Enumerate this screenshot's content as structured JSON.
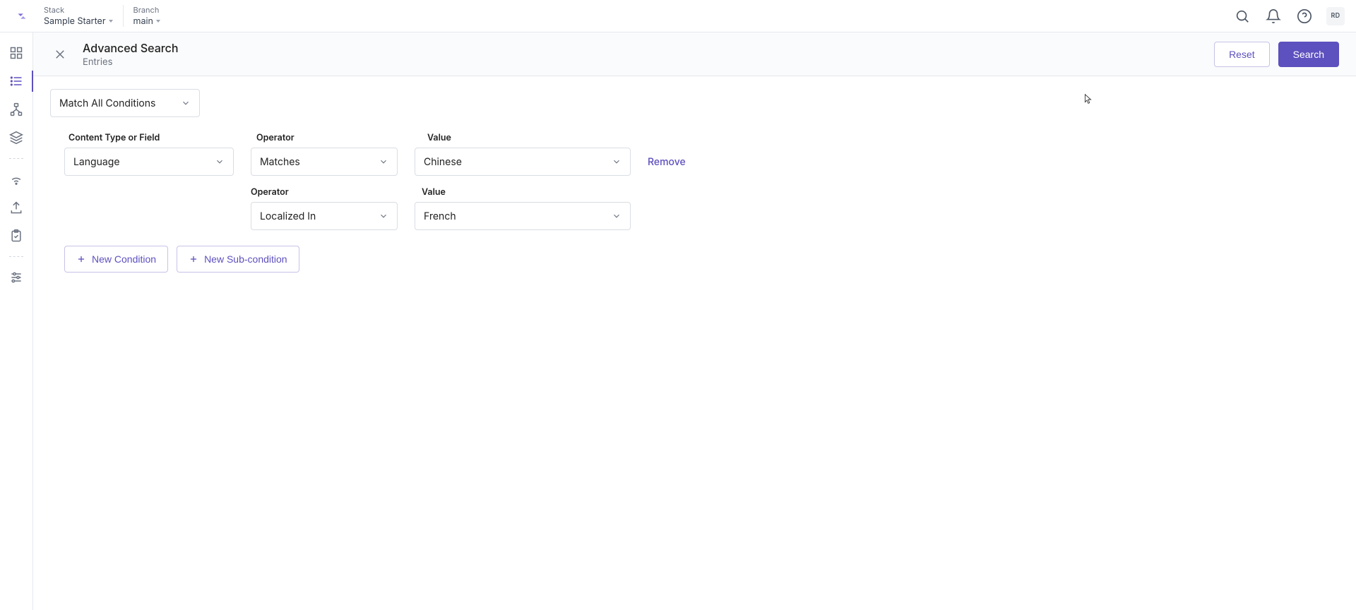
{
  "header": {
    "stack_label": "Stack",
    "stack_value": "Sample Starter",
    "branch_label": "Branch",
    "branch_value": "main",
    "avatar": "RD"
  },
  "subheader": {
    "title": "Advanced Search",
    "subtitle": "Entries",
    "reset": "Reset",
    "search": "Search"
  },
  "match": {
    "label": "Match All Conditions"
  },
  "labels": {
    "content_type": "Content Type or Field",
    "operator": "Operator",
    "value": "Value"
  },
  "condition1": {
    "field": "Language",
    "operator": "Matches",
    "value": "Chinese",
    "remove": "Remove"
  },
  "condition2": {
    "operator": "Localized In",
    "value": "French"
  },
  "actions": {
    "new_condition": "New Condition",
    "new_subcondition": "New Sub-condition"
  }
}
